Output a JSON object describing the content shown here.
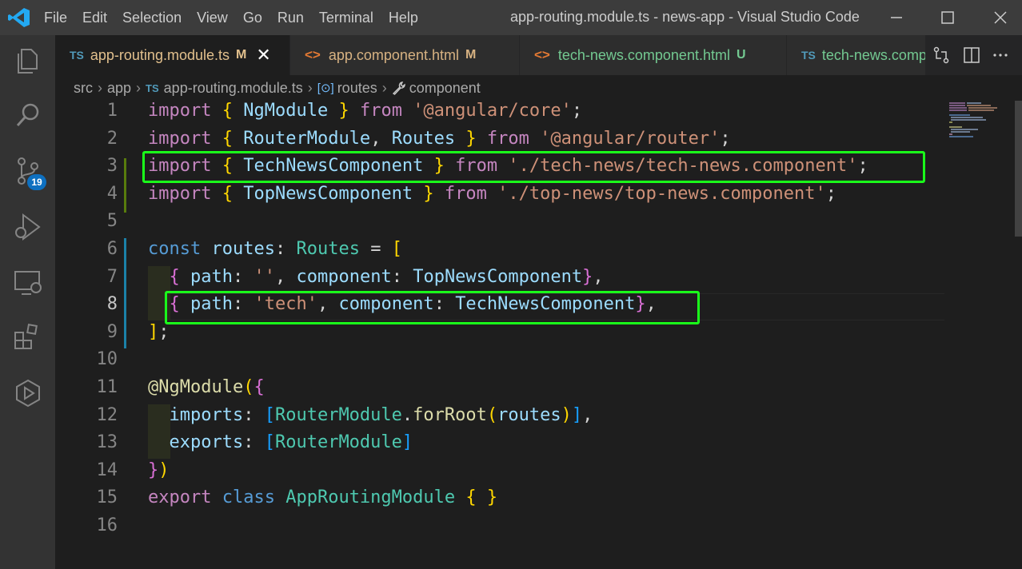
{
  "window": {
    "title": "app-routing.module.ts - news-app - Visual Studio Code"
  },
  "menu": [
    "File",
    "Edit",
    "Selection",
    "View",
    "Go",
    "Run",
    "Terminal",
    "Help"
  ],
  "activity_bar": {
    "source_control_badge": "19"
  },
  "tabs": [
    {
      "icon": "TS",
      "label": "app-routing.module.ts",
      "status": "M",
      "active": true,
      "close": "✕"
    },
    {
      "icon": "<>",
      "label": "app.component.html",
      "status": "M",
      "active": false
    },
    {
      "icon": "<>",
      "label": "tech-news.component.html",
      "status": "U",
      "active": false
    },
    {
      "icon": "TS",
      "label": "tech-news.comp",
      "status": "",
      "active": false
    }
  ],
  "breadcrumb": {
    "items": [
      "src",
      "app"
    ],
    "file_icon": "TS",
    "file": "app-routing.module.ts",
    "symbol1": "routes",
    "symbol2": "component",
    "separator": "›"
  },
  "editor": {
    "line_numbers": [
      "1",
      "2",
      "3",
      "4",
      "5",
      "6",
      "7",
      "8",
      "9",
      "10",
      "11",
      "12",
      "13",
      "14",
      "15",
      "16"
    ],
    "tokens": {
      "import": "import",
      "from": "from",
      "const": "const",
      "export": "export",
      "class": "class",
      "NgModule": "NgModule",
      "angular_core": "'@angular/core'",
      "RouterModule": "RouterModule",
      "Routes": "Routes",
      "angular_router": "'@angular/router'",
      "TechNewsComponent": "TechNewsComponent",
      "tech_news_path": "'./tech-news/tech-news.component'",
      "TopNewsComponent": "TopNewsComponent",
      "top_news_path": "'./top-news/top-news.component'",
      "routes": "routes",
      "path": "path",
      "component": "component",
      "empty_str": "''",
      "tech_str": "'tech'",
      "at_NgModule": "@NgModule",
      "imports": "imports",
      "exports": "exports",
      "forRoot": "forRoot",
      "AppRoutingModule": "AppRoutingModule"
    }
  },
  "colors": {
    "highlight_box": "#1aff1a",
    "accent": "#0e70c0"
  }
}
